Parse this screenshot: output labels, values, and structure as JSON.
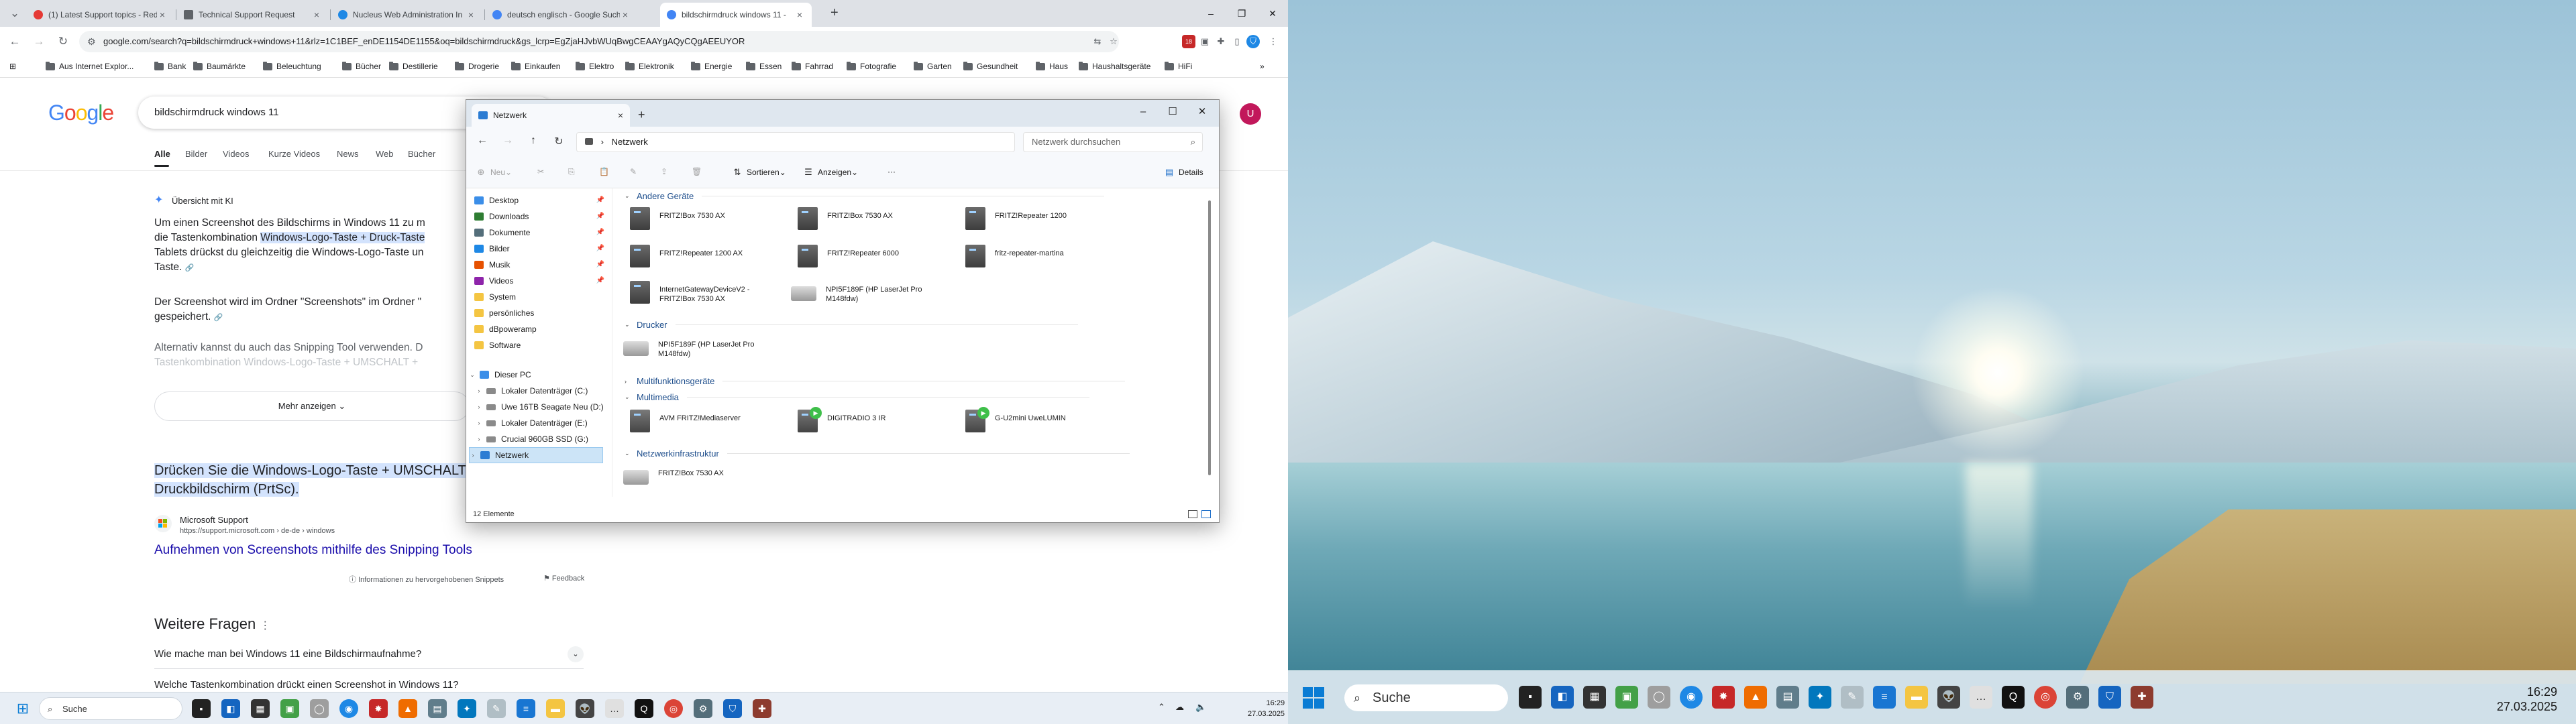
{
  "browser": {
    "tabs": [
      {
        "title": "(1) Latest Support topics - Red",
        "favicon_color": "#e53935"
      },
      {
        "title": "Technical Support Request",
        "favicon_color": "#5f6368"
      },
      {
        "title": "Nucleus Web Administration In",
        "favicon_color": "#1e88e5"
      },
      {
        "title": "deutsch englisch - Google Such",
        "favicon_color": "#4285f4"
      },
      {
        "title": "bildschirmdruck windows 11 -",
        "favicon_color": "#4285f4"
      }
    ],
    "url": "google.com/search?q=bildschirmdruck+windows+11&rlz=1C1BEF_enDE1154DE1155&oq=bildschirmdruck&gs_lcrp=EgZjaHJvbWUqBwgCEAAYgAQyCQgAEEUYOR",
    "bookmarks": [
      "Aus Internet Explor...",
      "Bank",
      "Baumärkte",
      "Beleuchtung",
      "Bücher",
      "Destillerie",
      "Drogerie",
      "Einkaufen",
      "Elektro",
      "Elektronik",
      "Energie",
      "Essen",
      "Fahrrad",
      "Fotografie",
      "Garten",
      "Gesundheit",
      "Haus",
      "Haushaltsgeräte",
      "HiFi"
    ],
    "ext_badge": "18"
  },
  "google": {
    "logo": "Google",
    "query": "bildschirmdruck windows 11",
    "avatar": "U",
    "tabs": [
      "Alle",
      "Bilder",
      "Videos",
      "Kurze Videos",
      "News",
      "Web",
      "Bücher"
    ],
    "ai_title": "Übersicht mit KI",
    "ai_p1_a": "Um einen Screenshot des Bildschirms in Windows 11 zu m",
    "ai_p1_b": "die Tastenkombination ",
    "ai_p1_hl": "Windows-Logo-Taste + Druck-Taste",
    "ai_p1_c": "Tablets drückst du gleichzeitig die Windows-Logo-Taste un",
    "ai_p1_d": "Taste.",
    "ai_p2_a": "Der Screenshot wird im Ordner \"Screenshots\" im Ordner \"",
    "ai_p2_b": "gespeichert.",
    "ai_p3_a": "Alternativ kannst du auch das Snipping Tool verwenden. D",
    "ai_p3_b": "Tastenkombination Windows-Logo-Taste + UMSCHALT +",
    "more": "Mehr anzeigen",
    "snippet_hl": "Drücken Sie die Windows-Logo-Taste + UMSCHALT",
    "snippet_rest": "Druckbildschirm (PrtSc).",
    "source_name": "Microsoft Support",
    "source_url": "https://support.microsoft.com › de-de › windows",
    "source_title": "Aufnehmen von Screenshots mithilfe des Snipping Tools",
    "snippet_info": "Informationen zu hervorgehobenen Snippets",
    "feedback": "Feedback",
    "further_title": "Weitere Fragen",
    "questions": [
      "Wie mache man bei Windows 11 eine Bildschirmaufnahme?",
      "Welche Tastenkombination drückt einen Screenshot in Windows 11?"
    ]
  },
  "explorer": {
    "tab_title": "Netzwerk",
    "address": "Netzwerk",
    "search_placeholder": "Netzwerk durchsuchen",
    "commands": {
      "new": "Neu",
      "sort": "Sortieren",
      "view": "Anzeigen",
      "details": "Details"
    },
    "sidebar": [
      {
        "label": "Desktop",
        "color": "#3b8ee8",
        "pinned": true
      },
      {
        "label": "Downloads",
        "color": "#2e7d32",
        "pinned": true
      },
      {
        "label": "Dokumente",
        "color": "#546e7a",
        "pinned": true
      },
      {
        "label": "Bilder",
        "color": "#1e88e5",
        "pinned": true
      },
      {
        "label": "Musik",
        "color": "#e65100",
        "pinned": true
      },
      {
        "label": "Videos",
        "color": "#8e24aa",
        "pinned": true
      },
      {
        "label": "System",
        "color": "#f4c542",
        "pinned": false
      },
      {
        "label": "persönliches",
        "color": "#f4c542",
        "pinned": false
      },
      {
        "label": "dBpoweramp",
        "color": "#f4c542",
        "pinned": false
      },
      {
        "label": "Software",
        "color": "#f4c542",
        "pinned": false
      }
    ],
    "this_pc": "Dieser PC",
    "drives": [
      "Lokaler Datenträger (C:)",
      "Uwe 16TB Seagate Neu (D:)",
      "Lokaler Datenträger (E:)",
      "Crucial 960GB SSD (G:)"
    ],
    "network": "Netzwerk",
    "groups": {
      "andere": "Andere Geräte",
      "drucker": "Drucker",
      "multifunktion": "Multifunktionsgeräte",
      "multimedia": "Multimedia",
      "netzwerkinfra": "Netzwerkinfrastruktur"
    },
    "andere_items": [
      [
        "FRITZ!Box 7530 AX",
        ""
      ],
      [
        "FRITZ!Box 7530 AX",
        ""
      ],
      [
        "FRITZ!Repeater 1200",
        ""
      ],
      [
        "FRITZ!Repeater 1200 AX",
        ""
      ],
      [
        "FRITZ!Repeater 6000",
        ""
      ],
      [
        "fritz-repeater-martina",
        ""
      ],
      [
        "InternetGatewayDeviceV2 -",
        "FRITZ!Box 7530 AX"
      ],
      [
        "NPI5F189F (HP LaserJet Pro",
        "M148fdw)"
      ]
    ],
    "drucker_items": [
      [
        "NPI5F189F (HP LaserJet Pro",
        "M148fdw)"
      ]
    ],
    "multimedia_items": [
      "AVM FRITZ!Mediaserver",
      "DIGITRADIO 3 IR",
      "G-U2mini UweLUMIN"
    ],
    "infra_items": [
      "FRITZ!Box 7530 AX"
    ],
    "status": "12 Elemente"
  },
  "taskbar_left": {
    "search": "Suche",
    "time": "16:29",
    "date": "27.03.2025"
  },
  "taskbar_right": {
    "search": "Suche",
    "time": "16:29",
    "date": "27.03.2025"
  }
}
